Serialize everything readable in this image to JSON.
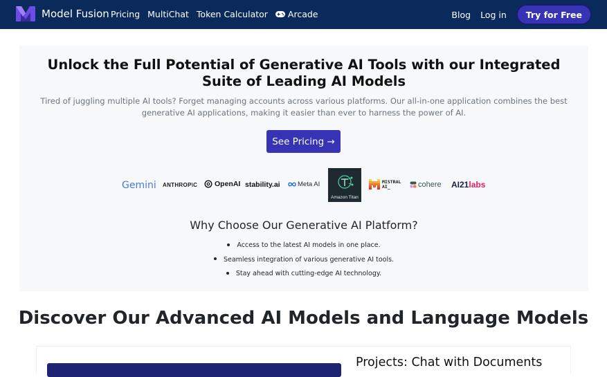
{
  "navbar": {
    "brand": "Model Fusion",
    "links": [
      "Pricing",
      "MultiChat",
      "Token Calculator",
      "Arcade"
    ],
    "blog": "Blog",
    "login": "Log in",
    "cta": "Try for Free",
    "colors": {
      "background": "#0a2a5b",
      "cta": "#3634b4"
    }
  },
  "hero": {
    "title": "Unlock the Full Potential of Generative AI Tools with our Integrated Suite of Leading AI Models",
    "subtitle": "Tired of juggling multiple AI tools? Forget managing accounts across various platforms. Our all-in-one application combines the best generative AI applications, making it easier than ever to harness the power of AI.",
    "pricing_button": "See Pricing →",
    "logos": {
      "gemini": "Gemini",
      "anthropic": "ANTHROP\\C",
      "openai": "OpenAI",
      "stability": "stability.ai",
      "meta": "Meta AI",
      "titan": "Amazon Titan",
      "mistral_line1": "MISTRAL",
      "mistral_line2": "AI_",
      "cohere": "cohere",
      "ai21_prefix": "AI21",
      "ai21_suffix": "labs"
    }
  },
  "why": {
    "title": "Why Choose Our Generative AI Platform?",
    "items": [
      "Access to the latest AI models in one place.",
      "Seamless integration of various generative AI tools.",
      "Stay ahead with cutting-edge AI technology."
    ]
  },
  "discover": {
    "title": "Discover Our Advanced AI Models and Language Models"
  },
  "card": {
    "title": "Projects: Chat with Documents"
  }
}
